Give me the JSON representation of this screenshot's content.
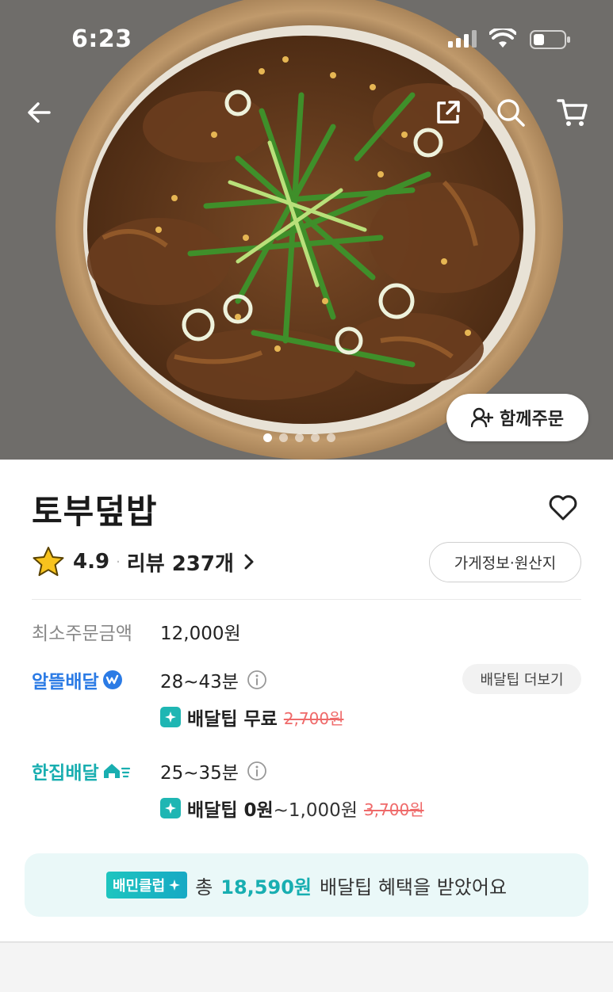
{
  "status_bar": {
    "time": "6:23"
  },
  "hero": {
    "group_order_label": "함께주문",
    "slides_count": 5,
    "active_slide": 1
  },
  "store": {
    "name": "토부덮밥",
    "rating": "4.9",
    "separator": "·",
    "review_label": "리뷰 237개",
    "info_button": "가게정보·원산지"
  },
  "min_order": {
    "label": "최소주문금액",
    "value": "12,000원"
  },
  "saver_delivery": {
    "label": "알뜰배달",
    "time": "28~43분",
    "tip_more_button": "배달팁 더보기",
    "tip_label": "배달팁 무료",
    "tip_original": "2,700원"
  },
  "single_delivery": {
    "label": "한집배달",
    "time": "25~35분",
    "tip_label": "배달팁 0원",
    "tip_range": "~1,000원",
    "tip_original": "3,700원"
  },
  "club_banner": {
    "badge": "배민클럽",
    "prefix": "총",
    "amount": "18,590원",
    "suffix": "배달팁 혜택을 받았어요"
  },
  "colors": {
    "saver_blue": "#2b7be5",
    "single_teal": "#19aeb0",
    "strike_red": "#ef6a6a",
    "club_bg": "#eaf8f8"
  },
  "icons": [
    "back-arrow-icon",
    "share-icon",
    "search-icon",
    "cart-icon",
    "add-person-icon",
    "heart-icon",
    "star-icon",
    "chevron-right-icon",
    "info-icon",
    "lightning-badge-icon",
    "house-speed-icon",
    "sparkle-icon"
  ]
}
